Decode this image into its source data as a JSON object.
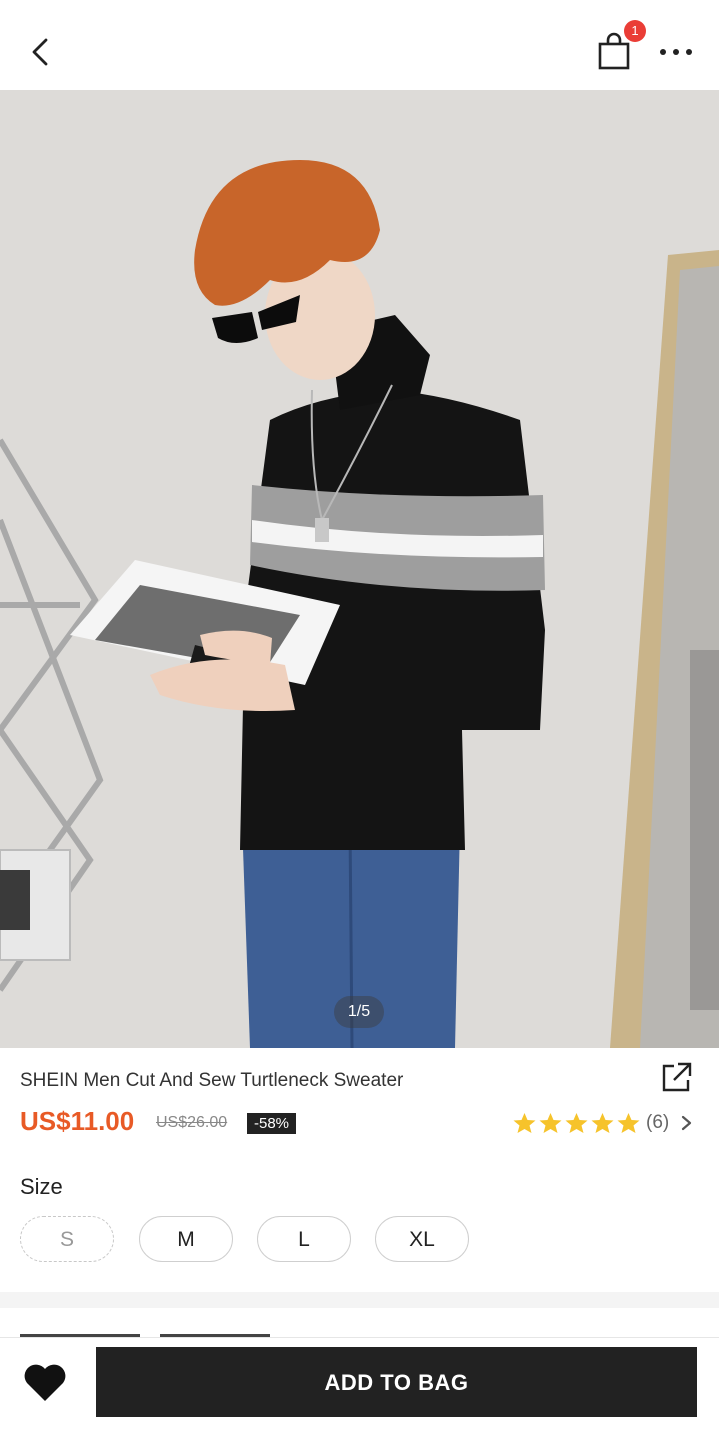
{
  "header": {
    "cart_count": "1",
    "icons": [
      "chevron-left-icon",
      "shopping-bag-icon",
      "more-dots-icon"
    ]
  },
  "gallery": {
    "counter": "1/5"
  },
  "product": {
    "title": "SHEIN Men Cut And Sew Turtleneck Sweater",
    "price": "US$11.00",
    "original_price": "US$26.00",
    "discount": "-58%",
    "rating_stars": 5,
    "rating_count": "(6)",
    "colors": {
      "price": "#e85a26",
      "star": "#f6c32b",
      "badge": "#ea3d36"
    }
  },
  "size": {
    "label": "Size",
    "options": [
      {
        "label": "S",
        "available": false
      },
      {
        "label": "M",
        "available": true
      },
      {
        "label": "L",
        "available": true
      },
      {
        "label": "XL",
        "available": true
      }
    ]
  },
  "bottom_bar": {
    "add_to_bag_label": "ADD TO BAG"
  }
}
